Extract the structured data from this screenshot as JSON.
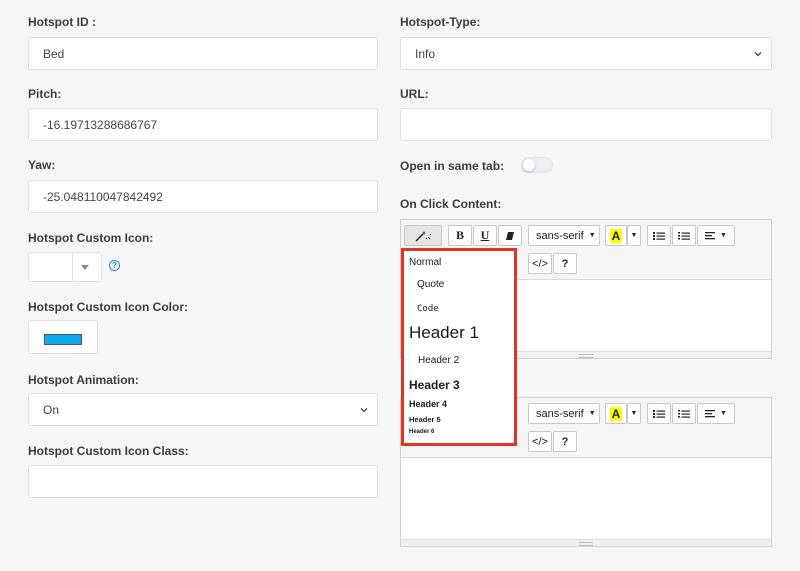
{
  "left": {
    "hotspot_id": {
      "label": "Hotspot ID :",
      "value": "Bed"
    },
    "pitch": {
      "label": "Pitch:",
      "value": "-16.19713288686767"
    },
    "yaw": {
      "label": "Yaw:",
      "value": "-25.048110047842492"
    },
    "custom_icon": {
      "label": "Hotspot Custom Icon:",
      "help": "?"
    },
    "custom_icon_color": {
      "label": "Hotspot Custom Icon Color:",
      "color": "#0aa8ec"
    },
    "animation": {
      "label": "Hotspot Animation:",
      "value": "On"
    },
    "custom_icon_class": {
      "label": "Hotspot Custom Icon Class:",
      "value": ""
    }
  },
  "right": {
    "hotspot_type": {
      "label": "Hotspot-Type:",
      "value": "Info"
    },
    "url": {
      "label": "URL:",
      "value": ""
    },
    "open_same_tab": {
      "label": "Open in same tab:",
      "on": false
    },
    "on_click_content": {
      "label": "On Click Content:"
    }
  },
  "editor": {
    "font_name": "sans-serif",
    "bold": "B",
    "underline": "U",
    "code": "</>",
    "help": "?",
    "highlight_letter": "A",
    "highlight_color": "#ffff00"
  },
  "style_dropdown": {
    "items": [
      "Normal",
      "Quote",
      "Code",
      "Header 1",
      "Header 2",
      "Header 3",
      "Header 4",
      "Header 5",
      "Header 6"
    ]
  }
}
